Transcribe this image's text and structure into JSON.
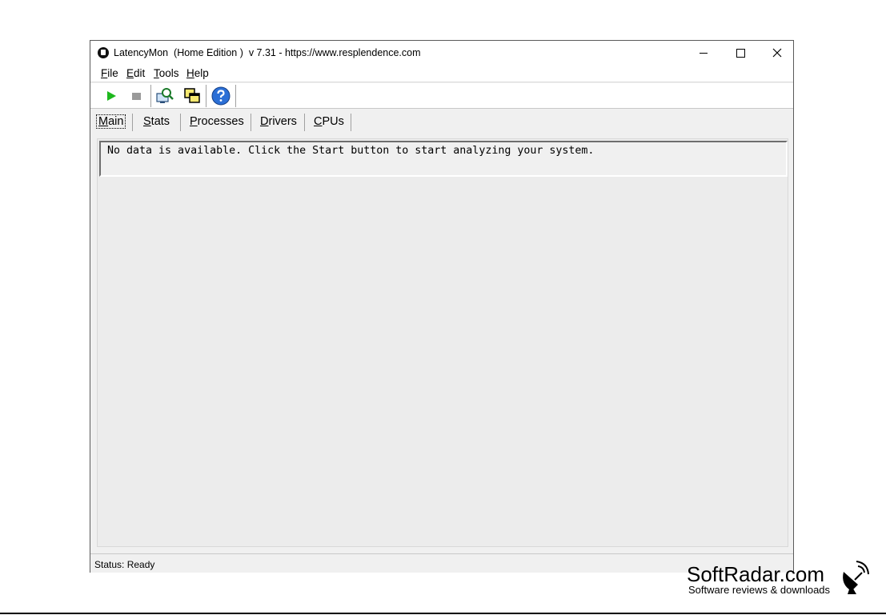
{
  "window": {
    "title": "LatencyMon  (Home Edition )  v 7.31 - https://www.resplendence.com"
  },
  "menu": [
    "File",
    "Edit",
    "Tools",
    "Help"
  ],
  "toolbar": {
    "buttons": [
      {
        "name": "start-button",
        "icon": "play-icon",
        "color": "#1db81d"
      },
      {
        "name": "stop-button",
        "icon": "stop-icon",
        "color": "#9a9a9a"
      },
      {
        "name": "analyze-tool-button",
        "icon": "magnifier-monitor-icon"
      },
      {
        "name": "windows-tool-button",
        "icon": "overlapping-windows-icon"
      },
      {
        "name": "help-button",
        "icon": "question-icon",
        "color": "#2b6fd6"
      }
    ]
  },
  "tabs": [
    {
      "label": "Main",
      "active": true
    },
    {
      "label": "Stats",
      "active": false
    },
    {
      "label": "Processes",
      "active": false
    },
    {
      "label": "Drivers",
      "active": false
    },
    {
      "label": "CPUs",
      "active": false
    }
  ],
  "main": {
    "message": "No data is available. Click the Start button to start analyzing your system."
  },
  "status": {
    "text": "Status: Ready"
  },
  "watermark": {
    "brand": "SoftRadar.com",
    "tagline": "Software reviews & downloads"
  }
}
